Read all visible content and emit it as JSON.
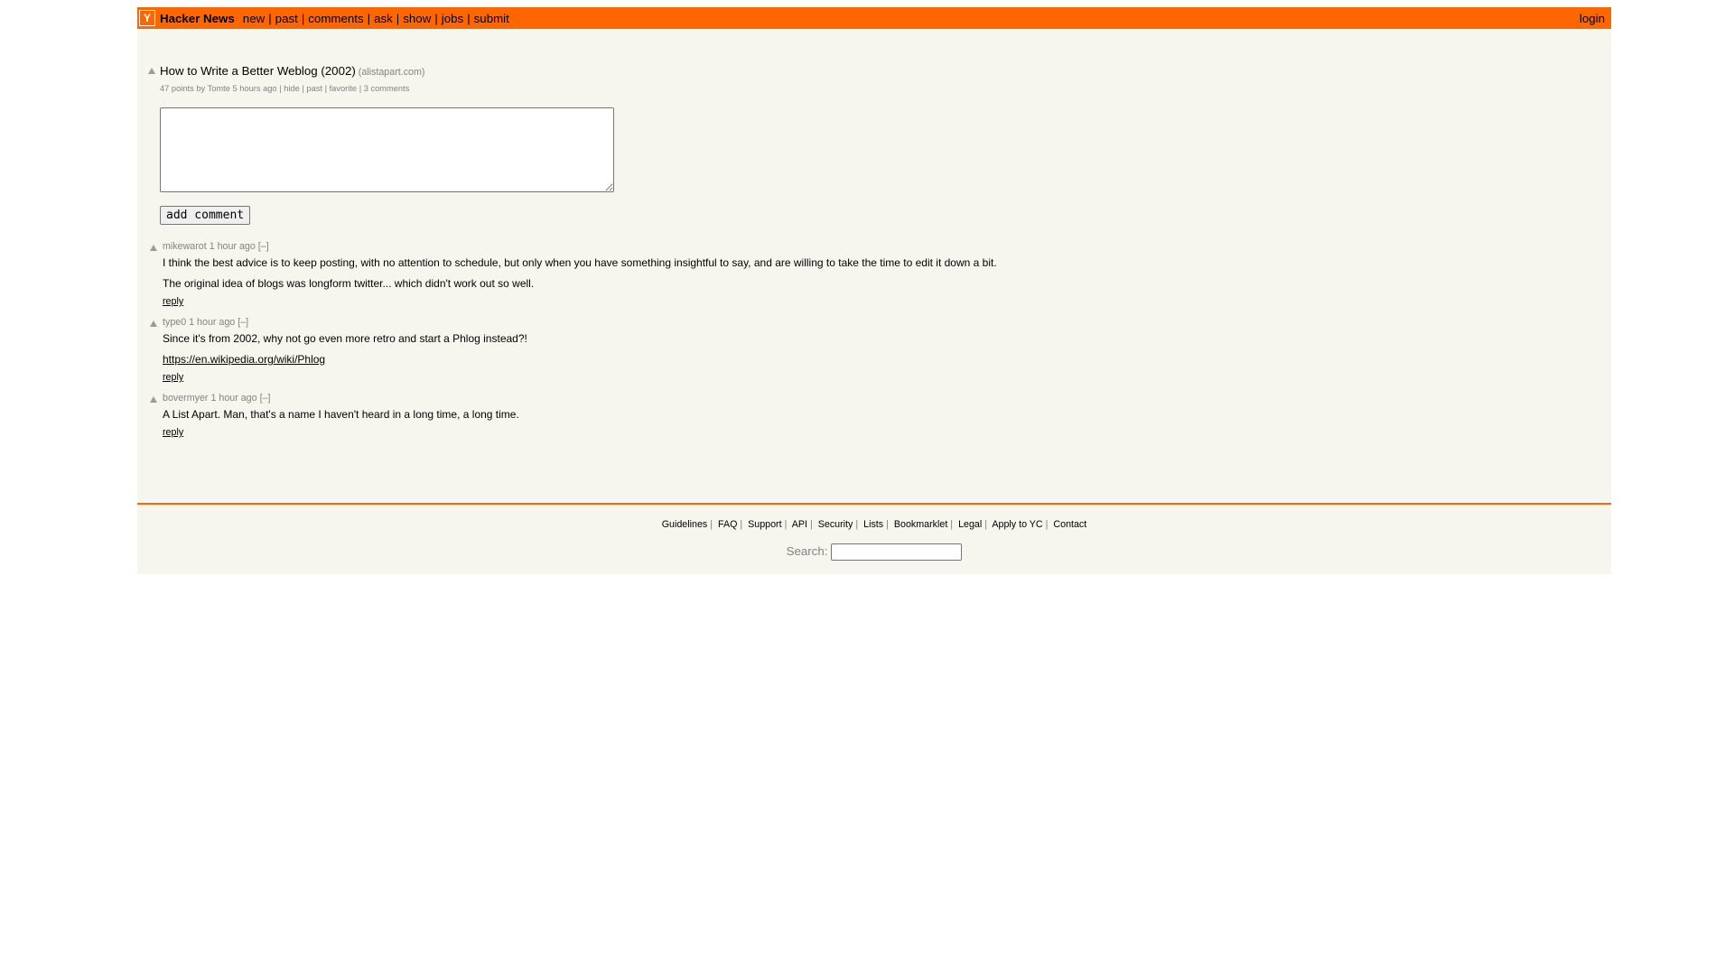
{
  "header": {
    "logo_letter": "Y",
    "site_name": "Hacker News",
    "nav": [
      "new",
      "past",
      "comments",
      "ask",
      "show",
      "jobs",
      "submit"
    ],
    "separator": "|",
    "login": "login"
  },
  "story": {
    "title": "How to Write a Better Weblog (2002)",
    "domain": "(alistapart.com)",
    "points": "47 points",
    "by": "by",
    "user": "Tomte",
    "age": "5 hours ago",
    "hide": "hide",
    "past": "past",
    "favorite": "favorite",
    "comments": "3 comments",
    "sep": "|"
  },
  "comment_form": {
    "textarea_value": "",
    "submit_label": "add comment"
  },
  "comments": [
    {
      "user": "mikewarot",
      "age": "1 hour ago",
      "toggle": "[–]",
      "paragraphs": [
        "I think the best advice is to keep posting, with no attention to schedule, but only when you have something insightful to say, and are willing to take the time to edit it down a bit.",
        "The original idea of blogs was longform twitter... which didn't work out so well."
      ],
      "reply": "reply"
    },
    {
      "user": "type0",
      "age": "1 hour ago",
      "toggle": "[–]",
      "paragraphs": [
        "Since it's from 2002, why not go even more retro and start a Phlog instead?!"
      ],
      "link": "https://en.wikipedia.org/wiki/Phlog",
      "reply": "reply"
    },
    {
      "user": "bovermyer",
      "age": "1 hour ago",
      "toggle": "[–]",
      "paragraphs": [
        "A List Apart. Man, that's a name I haven't heard in a long time, a long time."
      ],
      "reply": "reply"
    }
  ],
  "footer": {
    "links": [
      "Guidelines",
      "FAQ",
      "Support",
      "API",
      "Security",
      "Lists",
      "Bookmarklet",
      "Legal",
      "Apply to YC",
      "Contact"
    ],
    "separator": "|",
    "search_label": "Search:",
    "search_value": ""
  },
  "colors": {
    "brand_orange": "#ff6600",
    "page_bg": "#f6f6ef",
    "muted_text": "#828282"
  }
}
